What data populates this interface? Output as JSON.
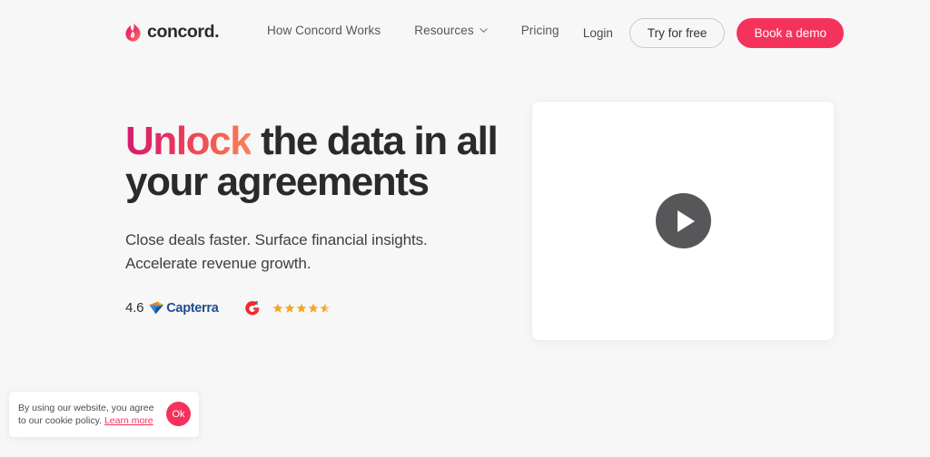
{
  "theme": {
    "page_bg": "#f7f7f8",
    "accent_pink": "#f5325b",
    "text_dark": "#2a2a2d",
    "gradient_start": "#d41b6e",
    "gradient_end": "#f8855c",
    "capterra_blue": "#1f4d8f",
    "g2_red": "#ef2a2a",
    "star_gold": "#f5a623",
    "play_gray": "#575759"
  },
  "header": {
    "brand": {
      "logo_icon": "concord-flame-logo-icon",
      "name": "concord."
    },
    "nav": [
      {
        "label": "How Concord Works",
        "has_dropdown": false
      },
      {
        "label": "Resources",
        "has_dropdown": true,
        "icon": "chevron-down-icon"
      },
      {
        "label": "Pricing",
        "has_dropdown": false
      }
    ],
    "actions": {
      "login_label": "Login",
      "try_label": "Try for free",
      "demo_label": "Book a demo"
    }
  },
  "hero": {
    "title_highlight": "Unlock",
    "title_rest": " the data in all your agreements",
    "subtitle_line1": "Close deals faster. Surface financial insights.",
    "subtitle_line2": "Accelerate revenue growth.",
    "ratings": [
      {
        "score": "4.6",
        "platform": "Capterra",
        "icon": "capterra-arrow-icon"
      },
      {
        "platform": "G2",
        "icon": "g2-logo-icon",
        "stars_filled": 4.5,
        "stars_total": 5
      }
    ]
  },
  "video": {
    "play_icon": "play-triangle-icon",
    "aria_label": "Play video"
  },
  "cookie_banner": {
    "text_part1": "By using our website, you agree to our cookie policy. ",
    "link_label": "Learn more",
    "ok_label": "Ok"
  }
}
